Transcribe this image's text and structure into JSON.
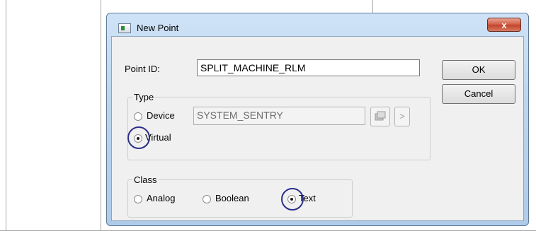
{
  "dialog": {
    "title": "New Point",
    "close_label": "x",
    "point_id": {
      "label": "Point ID:",
      "value": "SPLIT_MACHINE_RLM"
    },
    "buttons": {
      "ok": "OK",
      "cancel": "Cancel"
    },
    "type_group": {
      "title": "Type",
      "device_label": "Device",
      "device_value": "SYSTEM_SENTRY",
      "browse_label": ">",
      "virtual_label": "Virtual",
      "selected": "Virtual"
    },
    "class_group": {
      "title": "Class",
      "analog_label": "Analog",
      "boolean_label": "Boolean",
      "text_label": "Text",
      "selected": "Text"
    }
  }
}
